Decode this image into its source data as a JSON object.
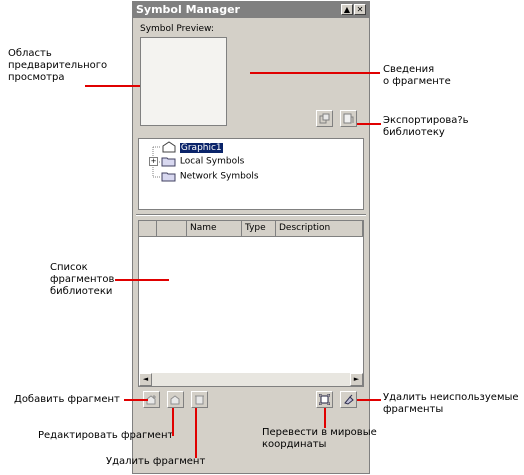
{
  "window": {
    "title": "Symbol Manager",
    "minimize_glyph": "▲",
    "close_glyph": "✕",
    "preview_label": "Symbol Preview:"
  },
  "tree": {
    "items": [
      {
        "label": "Graphic1",
        "selected": true,
        "icon": "document-arrow-icon"
      },
      {
        "label": "Local Symbols",
        "expander": "+",
        "icon": "folder-icon"
      },
      {
        "label": "Network Symbols",
        "icon": "folder-icon"
      }
    ]
  },
  "list": {
    "columns": [
      "",
      "",
      "Name",
      "Type",
      "Description"
    ]
  },
  "scroll": {
    "left": "◄",
    "right": "►"
  },
  "annotations": {
    "preview_area": "Область\nпредварительного\nпросмотра",
    "info": "Сведения\nо фрагменте",
    "export": "Экспортирова?ь\nбиблиотеку",
    "library_list": "Список\nфрагментов\nбиблиотеки",
    "add": "Добавить фрагмент",
    "edit": "Редактировать фрагмент",
    "delete": "Удалить фрагмент",
    "world_coords": "Перевести в мировые\nкоординаты",
    "remove_unused": "Удалить неиспользуемые\nфрагменты"
  },
  "colors": {
    "accent_line": "#e00000",
    "selection": "#0a246a"
  }
}
